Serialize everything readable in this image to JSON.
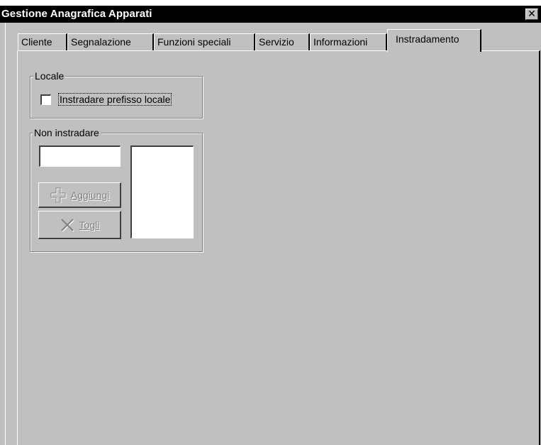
{
  "window": {
    "title": "Gestione Anagrafica Apparati",
    "close_glyph": "✕"
  },
  "tabs": [
    {
      "label": "Cliente",
      "active": false
    },
    {
      "label": "Segnalazione",
      "active": false
    },
    {
      "label": "Funzioni speciali",
      "active": false
    },
    {
      "label": "Servizio",
      "active": false
    },
    {
      "label": "Informazioni",
      "active": false
    },
    {
      "label": "Instradamento",
      "active": true
    }
  ],
  "locale_group": {
    "legend": "Locale",
    "checkbox_label": "Instradare prefisso locale",
    "checked": false
  },
  "non_instradare_group": {
    "legend": "Non instradare",
    "input_value": "",
    "add_button": {
      "label": "Aggiungi",
      "icon": "plus-icon",
      "enabled": false
    },
    "remove_button": {
      "label": "Togli",
      "icon": "x-icon",
      "enabled": false
    },
    "list_items": []
  },
  "colors": {
    "face": "#c0c0c0",
    "titlebar": "#000000",
    "disabled_text": "#808080"
  }
}
